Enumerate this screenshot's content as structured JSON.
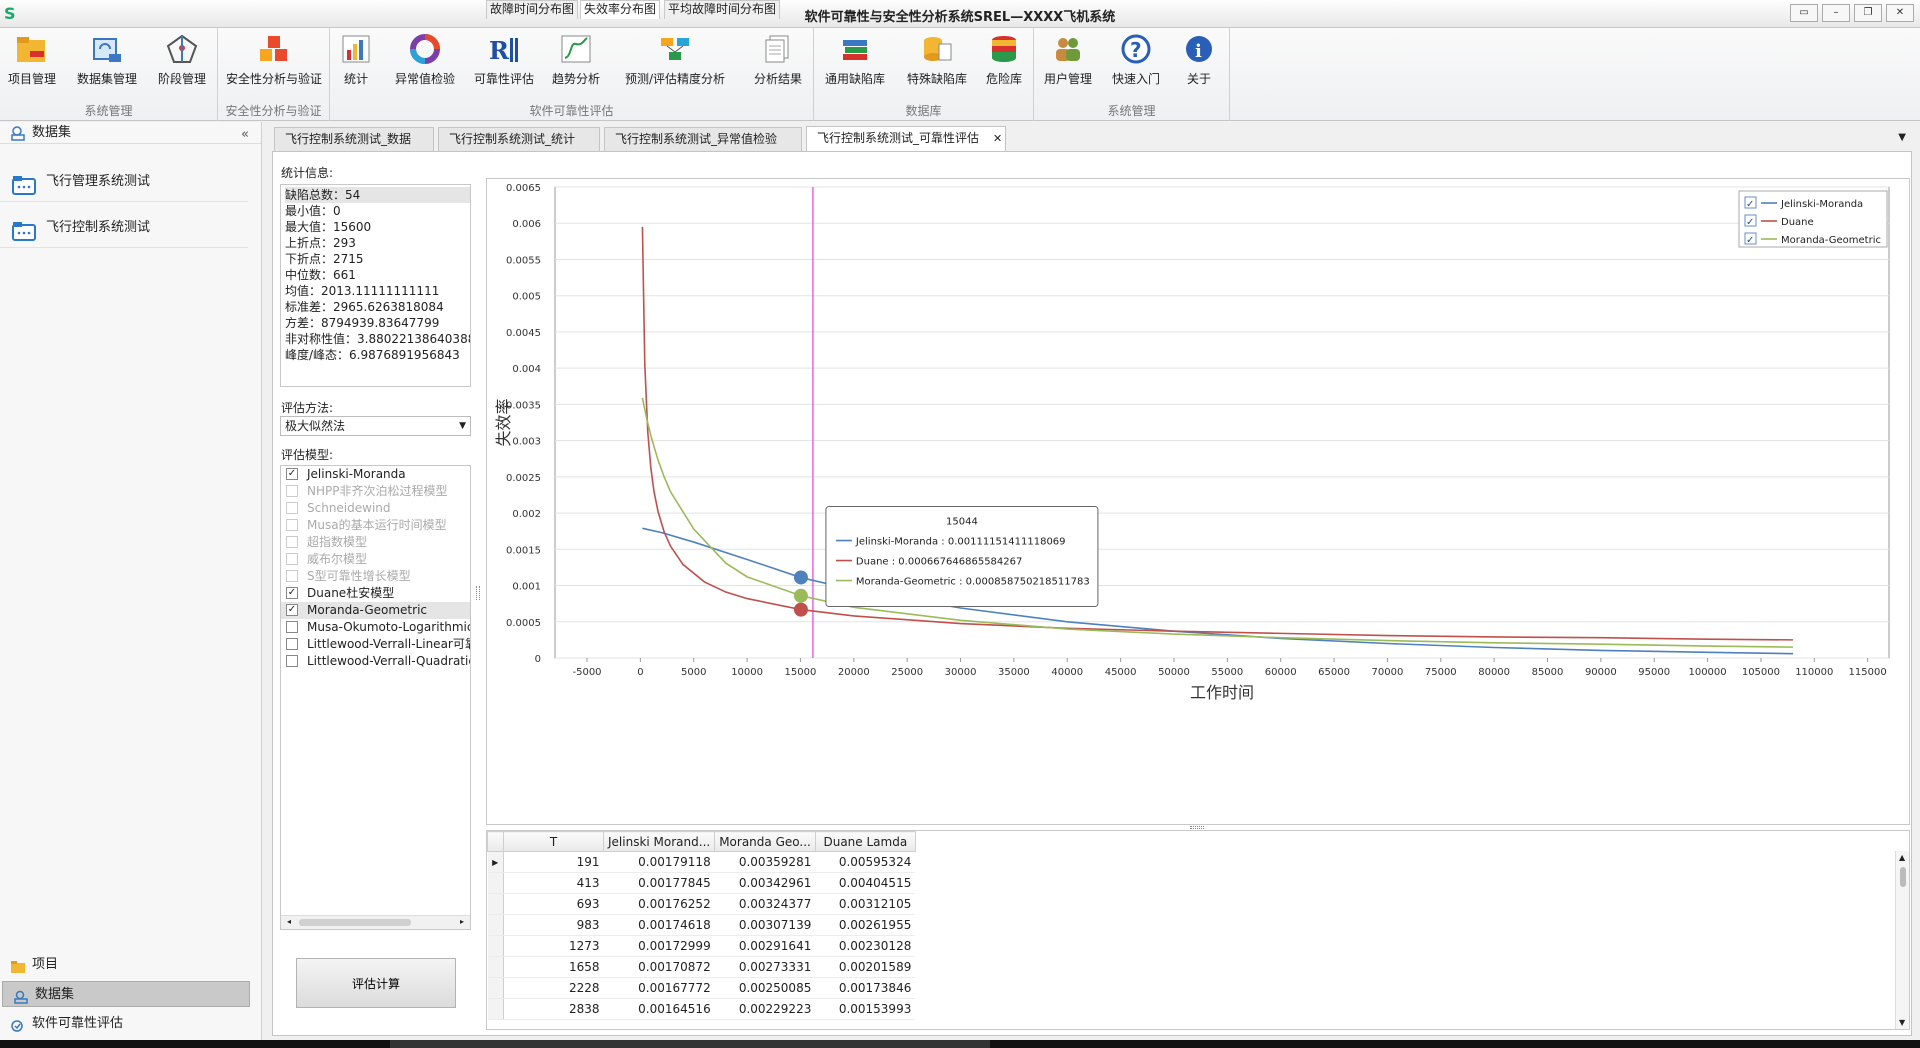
{
  "window": {
    "title": "软件可靠性与安全性分析系统SREL—XXXX飞机系统",
    "logo": "S"
  },
  "ribbon": {
    "groups": [
      {
        "caption": "系统管理",
        "buttons": [
          {
            "label": "项目管理"
          },
          {
            "label": "数据集管理"
          },
          {
            "label": "阶段管理"
          }
        ]
      },
      {
        "caption": "安全性分析与验证",
        "buttons": [
          {
            "label": "安全性分析与验证"
          }
        ]
      },
      {
        "caption": "软件可靠性评估",
        "buttons": [
          {
            "label": "统计"
          },
          {
            "label": "异常值检验"
          },
          {
            "label": "可靠性评估"
          },
          {
            "label": "趋势分析"
          },
          {
            "label": "预测/评估精度分析"
          },
          {
            "label": "分析结果"
          }
        ]
      },
      {
        "caption": "数据库",
        "buttons": [
          {
            "label": "通用缺陷库"
          },
          {
            "label": "特殊缺陷库"
          },
          {
            "label": "危险库"
          }
        ]
      },
      {
        "caption": "系统管理",
        "buttons": [
          {
            "label": "用户管理"
          },
          {
            "label": "快速入门"
          },
          {
            "label": "关于"
          }
        ]
      }
    ]
  },
  "left_panel": {
    "header": "数据集",
    "collapse": "«",
    "datasets": [
      "飞行管理系统测试",
      "飞行控制系统测试"
    ],
    "bottom_nav": [
      "项目",
      "数据集",
      "软件可靠性评估"
    ]
  },
  "tabs": [
    {
      "label": "飞行控制系统测试_数据"
    },
    {
      "label": "飞行控制系统测试_统计"
    },
    {
      "label": "飞行控制系统测试_异常值检验"
    },
    {
      "label": "飞行控制系统测试_可靠性评估",
      "close": "✕"
    }
  ],
  "stats": {
    "label": "统计信息:",
    "rows": [
      "缺陷总数：54",
      "最小值：0",
      "最大值：15600",
      "上折点：293",
      "下折点：2715",
      "中位数：661",
      "均值：2013.11111111111",
      "标准差：2965.6263818084",
      "方差：8794939.83647799",
      "非对称性值：3.88022138640388",
      "峰度/峰态：6.9876891956843"
    ]
  },
  "method": {
    "label": "评估方法:",
    "value": "极大似然法"
  },
  "models": {
    "label": "评估模型:",
    "items": [
      {
        "name": "Jelinski-Moranda",
        "checked": true,
        "enabled": true
      },
      {
        "name": "NHPP非齐次泊松过程模型",
        "checked": false,
        "enabled": false
      },
      {
        "name": "Schneidewind",
        "checked": false,
        "enabled": false
      },
      {
        "name": "Musa的基本运行时间模型",
        "checked": false,
        "enabled": false
      },
      {
        "name": "超指数模型",
        "checked": false,
        "enabled": false
      },
      {
        "name": "威布尔模型",
        "checked": false,
        "enabled": false
      },
      {
        "name": "S型可靠性增长模型",
        "checked": false,
        "enabled": false
      },
      {
        "name": "Duane杜安模型",
        "checked": true,
        "enabled": true
      },
      {
        "name": "Moranda-Geometric",
        "checked": true,
        "enabled": true
      },
      {
        "name": "Musa-Okumoto-Logarithmic泊",
        "checked": false,
        "enabled": true
      },
      {
        "name": "Littlewood-Verrall-Linear可靠性",
        "checked": false,
        "enabled": true
      },
      {
        "name": "Littlewood-Verrall-Quadratic可",
        "checked": false,
        "enabled": true
      }
    ]
  },
  "calc_button": "评估计算",
  "subtabs": [
    "故障时间分布图",
    "失效率分布图",
    "平均故障时间分布图"
  ],
  "chart_data": {
    "type": "line",
    "xlabel": "工作时间",
    "ylabel": "失效率",
    "xlim": [
      -8000,
      117000
    ],
    "ylim": [
      0,
      0.0065
    ],
    "xticks": [
      -5000,
      0,
      5000,
      10000,
      15000,
      20000,
      25000,
      30000,
      35000,
      40000,
      45000,
      50000,
      55000,
      60000,
      65000,
      70000,
      75000,
      80000,
      85000,
      90000,
      95000,
      100000,
      105000,
      110000,
      115000
    ],
    "yticks": [
      0,
      0.0005,
      0.001,
      0.0015,
      0.002,
      0.0025,
      0.003,
      0.0035,
      0.004,
      0.0045,
      0.005,
      0.0055,
      0.006,
      0.0065
    ],
    "grid": true,
    "legend": "top-right",
    "series": [
      {
        "name": "Jelinski-Moranda",
        "color": "#4f81bd",
        "x": [
          191,
          2000,
          5000,
          10000,
          15044,
          20000,
          30000,
          40000,
          50000,
          60000,
          70000,
          80000,
          90000,
          100000,
          108000
        ],
        "y": [
          0.00179,
          0.00173,
          0.0016,
          0.00136,
          0.00111,
          0.00094,
          0.00069,
          0.0005,
          0.00037,
          0.00027,
          0.0002,
          0.000145,
          0.000105,
          7.8e-05,
          6e-05
        ]
      },
      {
        "name": "Duane",
        "color": "#c0504d",
        "x": [
          191,
          413,
          693,
          983,
          1273,
          1658,
          2228,
          2838,
          4000,
          6000,
          8000,
          10000,
          15044,
          20000,
          30000,
          40000,
          50000,
          60000,
          70000,
          80000,
          90000,
          100000,
          108000
        ],
        "y": [
          0.00595,
          0.00405,
          0.00312,
          0.00262,
          0.0023,
          0.00202,
          0.00174,
          0.00154,
          0.00129,
          0.00105,
          0.00091,
          0.00082,
          0.000668,
          0.00058,
          0.000475,
          0.00041,
          0.00037,
          0.00034,
          0.00031,
          0.00029,
          0.00028,
          0.00026,
          0.00025
        ]
      },
      {
        "name": "Moranda-Geometric",
        "color": "#9bbb59",
        "x": [
          191,
          413,
          693,
          983,
          1273,
          1658,
          2228,
          2838,
          5000,
          8000,
          10000,
          15044,
          20000,
          30000,
          40000,
          50000,
          60000,
          70000,
          80000,
          90000,
          100000,
          108000
        ],
        "y": [
          0.00359,
          0.00343,
          0.00324,
          0.00307,
          0.00292,
          0.00273,
          0.0025,
          0.00229,
          0.00178,
          0.00131,
          0.00112,
          0.000859,
          0.0007,
          0.00052,
          0.0004,
          0.00033,
          0.00028,
          0.00024,
          0.00021,
          0.00019,
          0.000165,
          0.00015
        ]
      }
    ],
    "crosshair": {
      "x": 15044,
      "label": "15044",
      "entries": [
        "Jelinski-Moranda : 0.00111151411118069",
        "Duane : 0.000667646865584267",
        "Moranda-Geometric : 0.000858750218511783"
      ],
      "values": [
        0.00111151411118069,
        0.000667646865584267,
        0.000858750218511783
      ]
    }
  },
  "grid": {
    "columns": [
      "T",
      "Jelinski Morand...",
      "Moranda Geo...",
      "Duane Lamda"
    ],
    "current_row_marker": "▶",
    "rows": [
      [
        "191",
        "0.00179118",
        "0.00359281",
        "0.00595324"
      ],
      [
        "413",
        "0.00177845",
        "0.00342961",
        "0.00404515"
      ],
      [
        "693",
        "0.00176252",
        "0.00324377",
        "0.00312105"
      ],
      [
        "983",
        "0.00174618",
        "0.00307139",
        "0.00261955"
      ],
      [
        "1273",
        "0.00172999",
        "0.00291641",
        "0.00230128"
      ],
      [
        "1658",
        "0.00170872",
        "0.00273331",
        "0.00201589"
      ],
      [
        "2228",
        "0.00167772",
        "0.00250085",
        "0.00173846"
      ],
      [
        "2838",
        "0.00164516",
        "0.00229223",
        "0.00153993"
      ]
    ]
  },
  "colors": {
    "accent_magenta": "#e040e0",
    "jm": "#4f81bd",
    "duane": "#c0504d",
    "mg": "#9bbb59"
  }
}
